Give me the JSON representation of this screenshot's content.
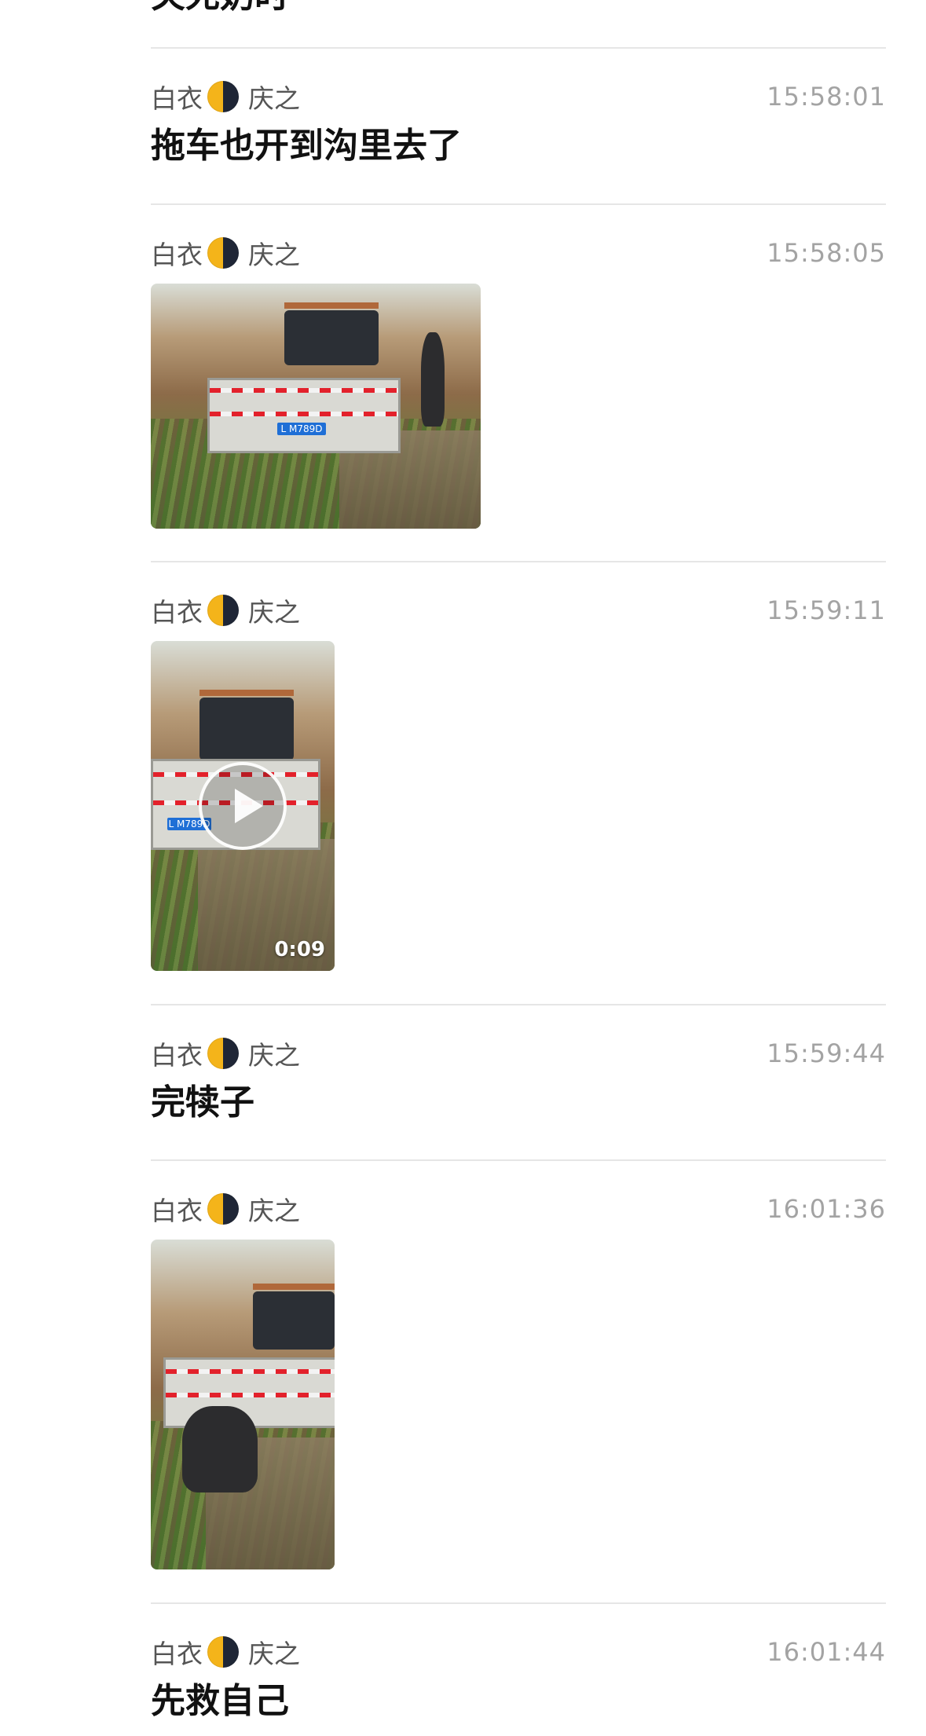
{
  "top_partial_text": "关死奶时",
  "messages": [
    {
      "sender_first": "白衣",
      "avatar_icon": "moon-icon",
      "sender_second": "庆之",
      "time": "15:58:01",
      "type": "text",
      "text": "拖车也开到沟里去了"
    },
    {
      "sender_first": "白衣",
      "avatar_icon": "moon-icon",
      "sender_second": "庆之",
      "time": "15:58:05",
      "type": "image",
      "plate": "L M789D"
    },
    {
      "sender_first": "白衣",
      "avatar_icon": "moon-icon",
      "sender_second": "庆之",
      "time": "15:59:11",
      "type": "video",
      "duration": "0:09",
      "plate": "L M789D"
    },
    {
      "sender_first": "白衣",
      "avatar_icon": "moon-icon",
      "sender_second": "庆之",
      "time": "15:59:44",
      "type": "text",
      "text": "完犊子"
    },
    {
      "sender_first": "白衣",
      "avatar_icon": "moon-icon",
      "sender_second": "庆之",
      "time": "16:01:36",
      "type": "image"
    },
    {
      "sender_first": "白衣",
      "avatar_icon": "moon-icon",
      "sender_second": "庆之",
      "time": "16:01:44",
      "type": "text",
      "text": "先救自己"
    }
  ],
  "colors": {
    "time": "#a3a3a3",
    "sender": "#555555",
    "divider": "#e6e6e6",
    "message_text": "#111111"
  }
}
